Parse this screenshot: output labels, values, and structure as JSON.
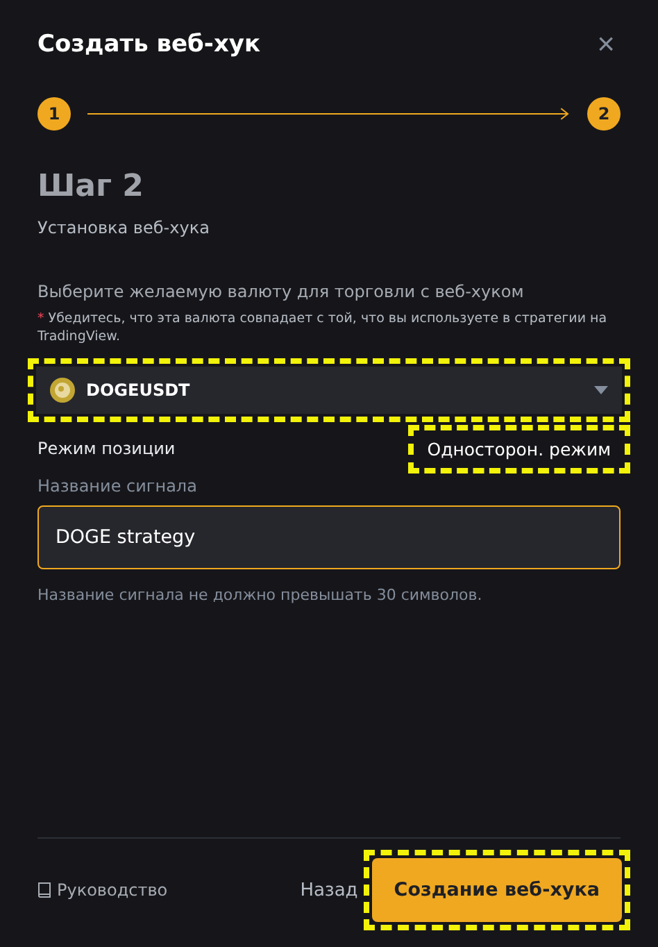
{
  "dialog": {
    "title": "Создать веб-хук",
    "close_icon": "×"
  },
  "steps": [
    {
      "label": "1",
      "selected": true
    },
    {
      "label": "2",
      "selected": true
    }
  ],
  "step_heading": "Шаг 2",
  "step_subtitle": "Установка веб-хука",
  "currency": {
    "label": "Выберите желаемую валюту для торговли с веб-хуком",
    "note_mark": "*",
    "note": "Убедитесь, что эта валюта совпадает с той, что вы используете в стратегии на TradingView.",
    "value": "DOGEUSDT",
    "highlighted": true
  },
  "position_mode": {
    "label": "Режим позиции",
    "value": "Односторон. режим",
    "highlighted": true
  },
  "signal_name": {
    "label": "Название сигнала",
    "value": "DOGE strategy",
    "hint": "Название сигнала не должно превышать 30 символов."
  },
  "footer": {
    "guide_link": "Руководство",
    "back_button": "Назад",
    "create_button": {
      "label": "Создание веб-хука",
      "highlighted": true
    }
  }
}
